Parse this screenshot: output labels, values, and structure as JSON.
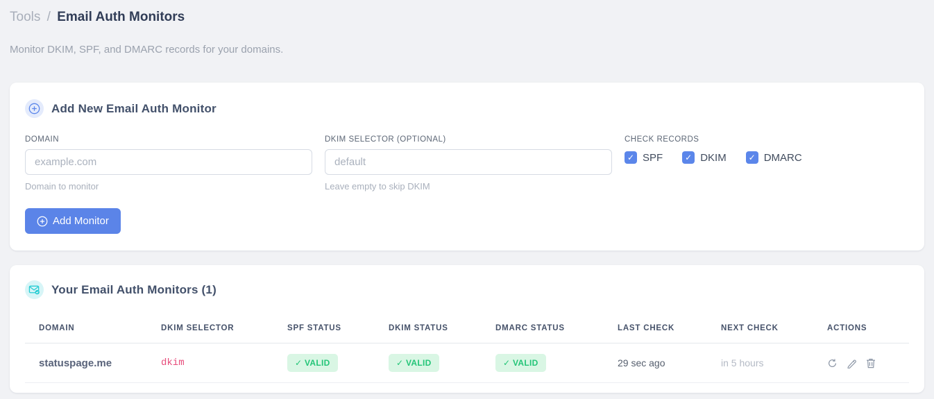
{
  "page": {
    "breadcrumb": {
      "section": "Tools",
      "separator": "/",
      "current": "Email Auth Monitors"
    },
    "subtitle": "Monitor DKIM, SPF, and DMARC records for your domains."
  },
  "add_monitor_card": {
    "title": "Add New Email Auth Monitor",
    "fields": {
      "domain": {
        "label": "DOMAIN",
        "placeholder": "example.com",
        "value": "",
        "helper": "Domain to monitor"
      },
      "dkim_selector": {
        "label": "DKIM SELECTOR (OPTIONAL)",
        "placeholder": "default",
        "value": "",
        "helper": "Leave empty to skip DKIM"
      }
    },
    "check_records": {
      "label": "CHECK RECORDS",
      "options": [
        {
          "label": "SPF",
          "checked": true
        },
        {
          "label": "DKIM",
          "checked": true
        },
        {
          "label": "DMARC",
          "checked": true
        }
      ]
    },
    "submit_label": "Add Monitor"
  },
  "monitors_card": {
    "title": "Your Email Auth Monitors (1)",
    "count": 1,
    "table": {
      "columns": [
        "DOMAIN",
        "DKIM SELECTOR",
        "SPF STATUS",
        "DKIM STATUS",
        "DMARC STATUS",
        "LAST CHECK",
        "NEXT CHECK",
        "ACTIONS"
      ],
      "rows": [
        {
          "domain": "statuspage.me",
          "dkim_selector": "dkim",
          "spf_status": "✓ VALID",
          "dkim_status": "✓ VALID",
          "dmarc_status": "✓ VALID",
          "last_check": "29 sec ago",
          "next_check": "in 5 hours",
          "actions": [
            "refresh",
            "edit",
            "delete"
          ]
        }
      ]
    }
  },
  "colors": {
    "accent_blue": "#5b84e8",
    "accent_teal": "#27ccd3",
    "badge_green_bg": "#d9f6e4",
    "badge_green_text": "#24c578",
    "selector_pink": "#e74c7b",
    "page_background": "#f1f2f5"
  }
}
